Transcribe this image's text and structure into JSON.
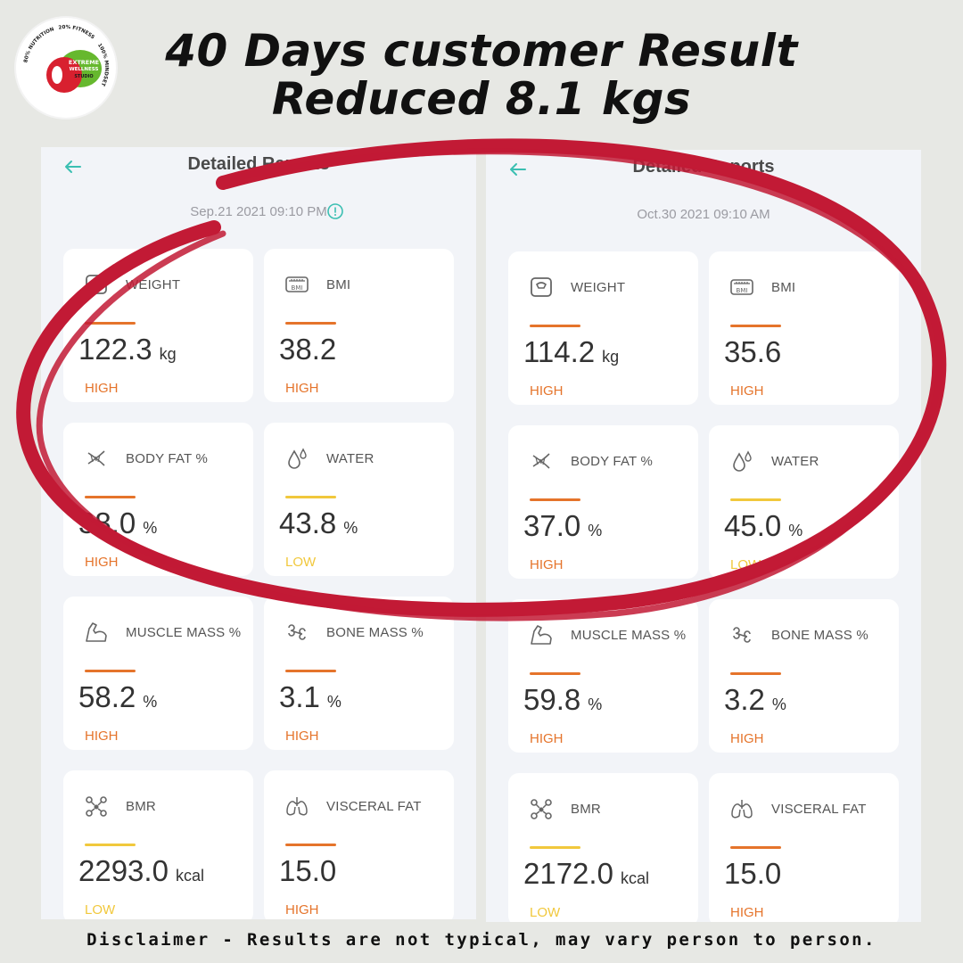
{
  "logo": {
    "ring_top": "20% FITNESS",
    "ring_left": "80% NUTRITION",
    "ring_right": "100% MINDSET",
    "line1": "EXTREME",
    "line2": "WELLNESS",
    "line3": "STUDIO"
  },
  "headline": {
    "line1": "40 Days customer Result",
    "line2": "Reduced 8.1 kgs"
  },
  "colors": {
    "high": "#e5742b",
    "low": "#f1c83c",
    "accent": "#3bbfb2",
    "ellipse": "#c21a35"
  },
  "reports": [
    {
      "title": "Detailed Reports",
      "datetime": "Sep.21 2021 09:10 PM",
      "cards": [
        {
          "label": "WEIGHT",
          "icon": "scale-icon",
          "value": "122.3",
          "unit": "kg",
          "status": "HIGH",
          "level": "high"
        },
        {
          "label": "BMI",
          "icon": "bmi-icon",
          "value": "38.2",
          "unit": "",
          "status": "HIGH",
          "level": "high"
        },
        {
          "label": "BODY FAT %",
          "icon": "body-fat-icon",
          "value": "38.0",
          "unit": "%",
          "status": "HIGH",
          "level": "high"
        },
        {
          "label": "WATER",
          "icon": "water-drop-icon",
          "value": "43.8",
          "unit": "%",
          "status": "LOW",
          "level": "low"
        },
        {
          "label": "MUSCLE MASS %",
          "icon": "muscle-arm-icon",
          "value": "58.2",
          "unit": "%",
          "status": "HIGH",
          "level": "high"
        },
        {
          "label": "BONE MASS %",
          "icon": "bone-icon",
          "value": "3.1",
          "unit": "%",
          "status": "HIGH",
          "level": "high"
        },
        {
          "label": "BMR",
          "icon": "molecule-icon",
          "value": "2293.0",
          "unit": "kcal",
          "status": "LOW",
          "level": "low"
        },
        {
          "label": "VISCERAL FAT",
          "icon": "lungs-icon",
          "value": "15.0",
          "unit": "",
          "status": "HIGH",
          "level": "high"
        }
      ]
    },
    {
      "title": "Detailed Reports",
      "datetime": "Oct.30 2021 09:10 AM",
      "cards": [
        {
          "label": "WEIGHT",
          "icon": "scale-icon",
          "value": "114.2",
          "unit": "kg",
          "status": "HIGH",
          "level": "high"
        },
        {
          "label": "BMI",
          "icon": "bmi-icon",
          "value": "35.6",
          "unit": "",
          "status": "HIGH",
          "level": "high"
        },
        {
          "label": "BODY FAT %",
          "icon": "body-fat-icon",
          "value": "37.0",
          "unit": "%",
          "status": "HIGH",
          "level": "high"
        },
        {
          "label": "WATER",
          "icon": "water-drop-icon",
          "value": "45.0",
          "unit": "%",
          "status": "LOW",
          "level": "low"
        },
        {
          "label": "MUSCLE MASS %",
          "icon": "muscle-arm-icon",
          "value": "59.8",
          "unit": "%",
          "status": "HIGH",
          "level": "high"
        },
        {
          "label": "BONE MASS %",
          "icon": "bone-icon",
          "value": "3.2",
          "unit": "%",
          "status": "HIGH",
          "level": "high"
        },
        {
          "label": "BMR",
          "icon": "molecule-icon",
          "value": "2172.0",
          "unit": "kcal",
          "status": "LOW",
          "level": "low"
        },
        {
          "label": "VISCERAL FAT",
          "icon": "lungs-icon",
          "value": "15.0",
          "unit": "",
          "status": "HIGH",
          "level": "high"
        }
      ]
    }
  ],
  "disclaimer": "Disclaimer - Results are not typical, may vary person to person."
}
